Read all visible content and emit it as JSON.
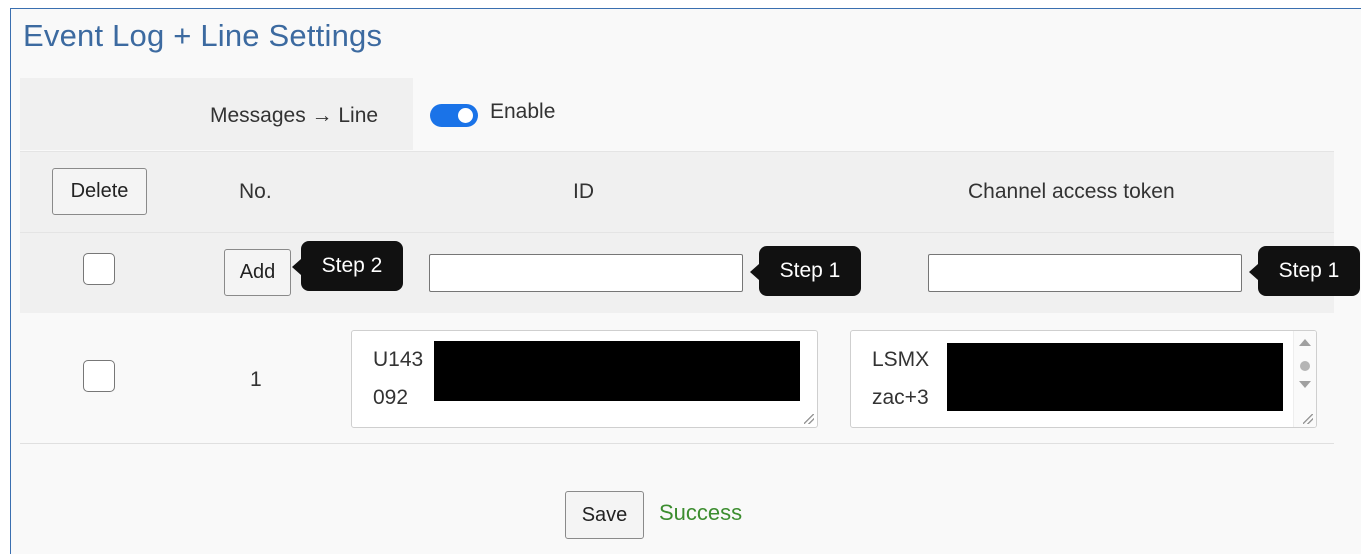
{
  "page": {
    "title": "Event Log + Line Settings"
  },
  "messages": {
    "label": "Messages → Line",
    "toggle_on": true,
    "enable_label": "Enable",
    "toggle_color": "#1a73e8"
  },
  "table": {
    "delete_label": "Delete",
    "col_no": "No.",
    "col_id": "ID",
    "col_token": "Channel access token"
  },
  "add_row": {
    "add_label": "Add",
    "checked": false,
    "id_value": "",
    "token_value": "",
    "tip_add": "Step 2",
    "tip_id": "Step 1",
    "tip_token": "Step 1"
  },
  "rows": [
    {
      "checked": false,
      "no": "1",
      "id_line1": "U143",
      "id_line2": "092",
      "token_line1": "LSMX",
      "token_line2": "zac+3",
      "redacted": true
    }
  ],
  "footer": {
    "save_label": "Save",
    "status_text": "Success",
    "status_color": "#3c8d2f"
  }
}
